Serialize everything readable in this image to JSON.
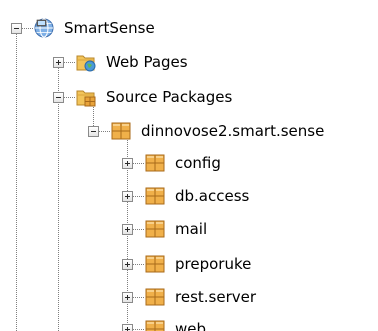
{
  "tree": {
    "root": {
      "label": "SmartSense",
      "icon": "globe-project-icon",
      "expanded": true,
      "children": [
        {
          "label": "Web Pages",
          "icon": "web-pages-folder-icon",
          "expanded": false
        },
        {
          "label": "Source Packages",
          "icon": "source-packages-folder-icon",
          "expanded": true,
          "children": [
            {
              "label": "dinnovose2.smart.sense",
              "icon": "package-icon",
              "expanded": true,
              "children": [
                {
                  "label": "config",
                  "icon": "package-icon",
                  "expanded": false
                },
                {
                  "label": "db.access",
                  "icon": "package-icon",
                  "expanded": false
                },
                {
                  "label": "mail",
                  "icon": "package-icon",
                  "expanded": false
                },
                {
                  "label": "preporuke",
                  "icon": "package-icon",
                  "expanded": false
                },
                {
                  "label": "rest.server",
                  "icon": "package-icon",
                  "expanded": false
                },
                {
                  "label": "web",
                  "icon": "package-icon",
                  "expanded": false
                }
              ]
            }
          ]
        }
      ]
    }
  },
  "colors": {
    "tree_line": "#7f7f7f",
    "package_orange": "#e8a33a",
    "folder_yellow": "#f2c45a",
    "globe_blue": "#4a7fc1"
  }
}
